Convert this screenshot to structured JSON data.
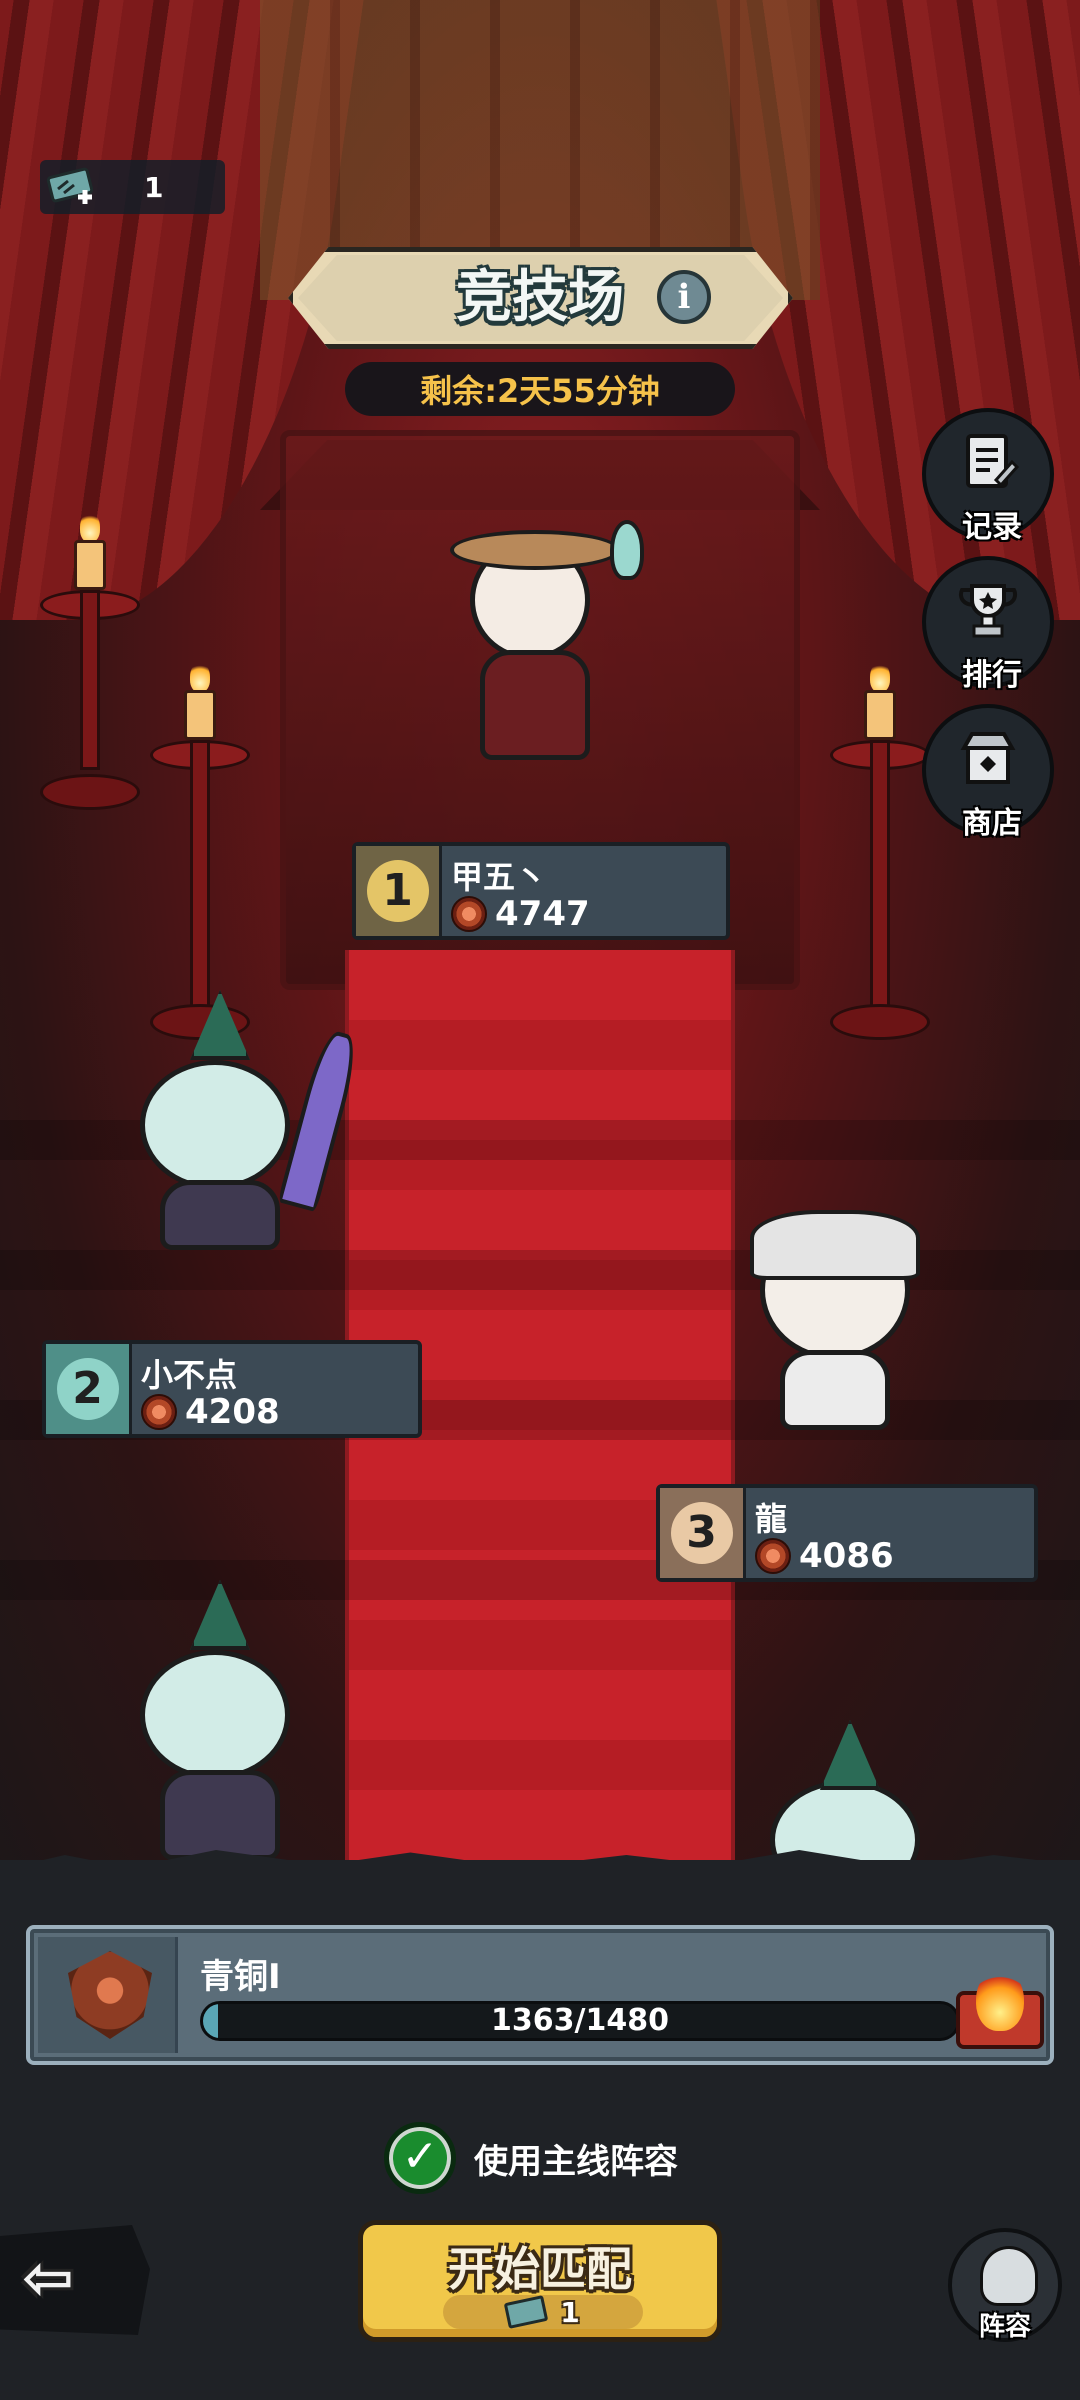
{
  "header": {
    "ticket_count": "1",
    "title": "竞技场",
    "info_icon": "i",
    "remaining": "剩余:2天55分钟"
  },
  "side_menu": [
    {
      "label": "记录",
      "icon": "record-icon"
    },
    {
      "label": "排行",
      "icon": "trophy-icon"
    },
    {
      "label": "商店",
      "icon": "shop-icon"
    }
  ],
  "leaderboard": [
    {
      "rank": "1",
      "name": "甲五丶",
      "score": "4747",
      "color": "#e4c567"
    },
    {
      "rank": "2",
      "name": "小不点",
      "score": "4208",
      "color": "#8fd3c8"
    },
    {
      "rank": "3",
      "name": "龍",
      "score": "4086",
      "color": "#e9c9a5"
    }
  ],
  "player_rank": {
    "tier": "青铜I",
    "progress_text": "1363/1480",
    "progress_current": 1363,
    "progress_max": 1480
  },
  "use_main_lineup": {
    "label": "使用主线阵容",
    "checked": true
  },
  "start_button": {
    "label": "开始匹配",
    "cost": "1"
  },
  "lineup_button": {
    "label": "阵容"
  },
  "colors": {
    "accent_gold": "#f1c84a",
    "check_green": "#1a8c2e",
    "remaining_text": "#f6c24a"
  }
}
